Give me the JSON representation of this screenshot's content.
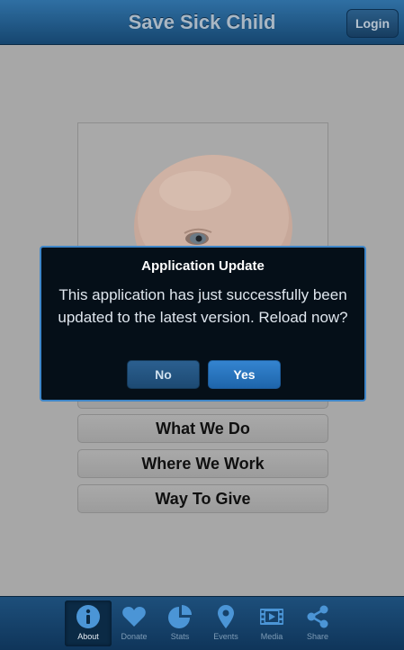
{
  "header": {
    "title": "Save Sick Child",
    "login_label": "Login"
  },
  "main": {
    "buttons": [
      {
        "label": "What We Do"
      },
      {
        "label": "Where We Work"
      },
      {
        "label": "Way To Give"
      }
    ]
  },
  "dialog": {
    "title": "Application Update",
    "message": "This application has just successfully been updated to the latest version. Reload now?",
    "no_label": "No",
    "yes_label": "Yes"
  },
  "tabbar": {
    "tabs": [
      {
        "label": "About",
        "icon": "info-icon",
        "active": true
      },
      {
        "label": "Donate",
        "icon": "heart-icon",
        "active": false
      },
      {
        "label": "Stats",
        "icon": "pie-chart-icon",
        "active": false
      },
      {
        "label": "Events",
        "icon": "map-pin-icon",
        "active": false
      },
      {
        "label": "Media",
        "icon": "film-icon",
        "active": false
      },
      {
        "label": "Share",
        "icon": "share-icon",
        "active": false
      }
    ]
  },
  "colors": {
    "header": "#1f5686",
    "overlay": "#a7a7a7",
    "dialog_bg": "#050f18",
    "dialog_border": "#3f86c8",
    "yes_button": "#2673bd",
    "tabbar": "#15416a"
  }
}
